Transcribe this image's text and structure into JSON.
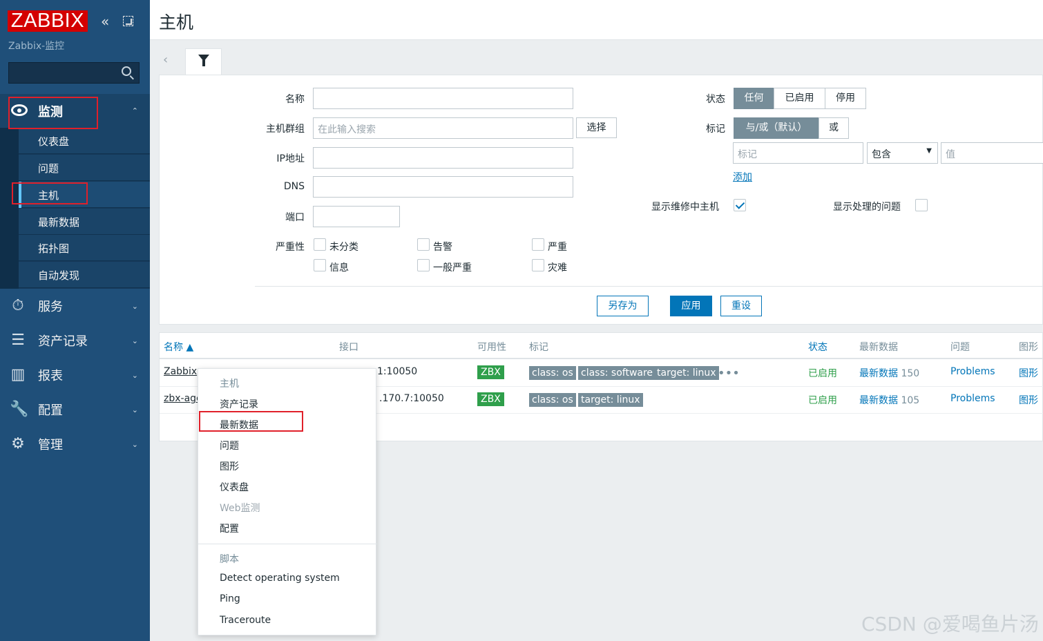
{
  "sidebar": {
    "logo": "ZABBIX",
    "server_name": "Zabbix-监控",
    "search_placeholder": "",
    "menu": {
      "monitoring": "监测",
      "services": "服务",
      "inventory": "资产记录",
      "reports": "报表",
      "configuration": "配置",
      "administration": "管理"
    },
    "submenu": [
      "仪表盘",
      "问题",
      "主机",
      "最新数据",
      "拓扑图",
      "自动发现"
    ]
  },
  "header": {
    "title": "主机"
  },
  "filter": {
    "name_label": "名称",
    "name_value": "",
    "hostgroup_label": "主机群组",
    "hostgroup_placeholder": "在此输入搜索",
    "select_button": "选择",
    "ip_label": "IP地址",
    "dns_label": "DNS",
    "port_label": "端口",
    "severity_label": "严重性",
    "severities": [
      "未分类",
      "告警",
      "严重",
      "信息",
      "一般严重",
      "灾难"
    ],
    "status_label": "状态",
    "status_options": [
      "任何",
      "已启用",
      "停用"
    ],
    "status_selected": "任何",
    "tags_label": "标记",
    "tags_options": [
      "与/或（默认）",
      "或"
    ],
    "tags_selected": "与/或（默认）",
    "tag_placeholder": "标记",
    "tag_operator": "包含",
    "tag_value_placeholder": "值",
    "add_link": "添加",
    "show_maintenance_label": "显示维修中主机",
    "show_maintenance_checked": true,
    "show_suppressed_label": "显示处理的问题",
    "show_suppressed_checked": false,
    "save_as": "另存为",
    "apply": "应用",
    "reset": "重设"
  },
  "table": {
    "columns": [
      "名称 ▲",
      "接口",
      "可用性",
      "标记",
      "状态",
      "最新数据",
      "问题",
      "图形"
    ],
    "rows": [
      {
        "name": "Zabbix",
        "interface": "1:10050",
        "availability": "ZBX",
        "tags": [
          "class: os",
          "class: software",
          "target: linux"
        ],
        "more": "•••",
        "status": "已启用",
        "latest_label": "最新数据",
        "latest_count": "150",
        "problems": "Problems",
        "graphs": "图形"
      },
      {
        "name": "zbx-age",
        "interface": ".170.7:10050",
        "availability": "ZBX",
        "tags": [
          "class: os",
          "target: linux"
        ],
        "status": "已启用",
        "latest_label": "最新数据",
        "latest_count": "105",
        "problems": "Problems",
        "graphs": "图形"
      }
    ]
  },
  "context_menu": {
    "host_header": "主机",
    "host_items": [
      "资产记录",
      "最新数据",
      "问题",
      "图形",
      "仪表盘",
      "Web监测",
      "配置"
    ],
    "scripts_header": "脚本",
    "script_items": [
      "Detect operating system",
      "Ping",
      "Traceroute"
    ]
  },
  "watermark": "CSDN @爱喝鱼片汤",
  "colors": {
    "sidebar_bg": "#1f4f79",
    "logo_red": "#d40000",
    "accent_blue": "#0275b8",
    "status_green": "#2f9f4b",
    "tag_grey": "#768d99",
    "highlight_red": "#e0202a"
  }
}
